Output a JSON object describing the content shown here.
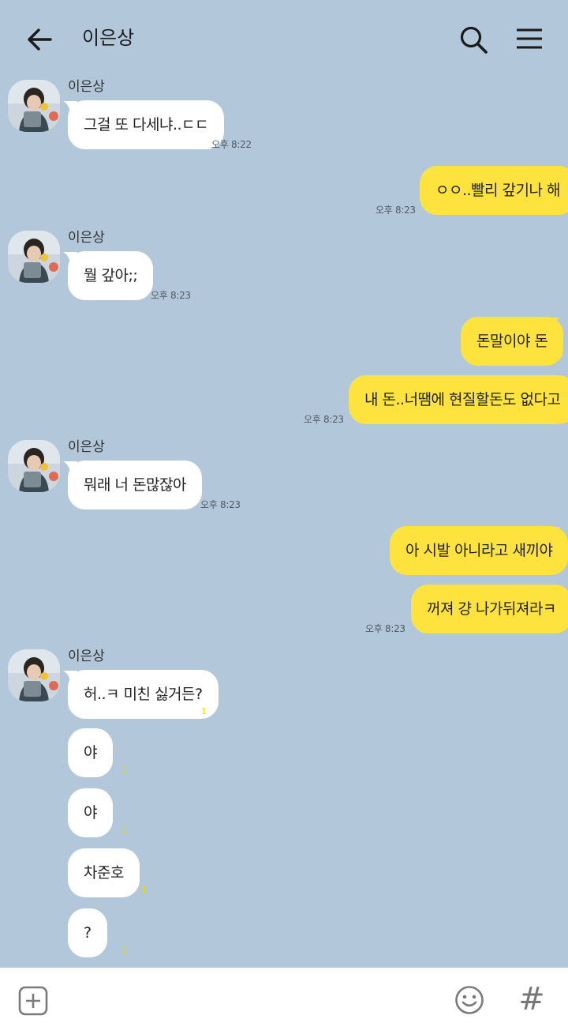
{
  "header": {
    "title": "이은상"
  },
  "sender_name": "이은상",
  "messages": {
    "m1": {
      "text": "그걸 또 다세냐..ㄷㄷ",
      "time": "오후 8:22"
    },
    "m2": {
      "text": "ㅇㅇ..빨리 갚기나 해",
      "time": "오후 8:23"
    },
    "m3": {
      "text": "뭘 갚아;;",
      "time": "오후 8:23"
    },
    "m4": {
      "text": "돈말이야 돈"
    },
    "m5": {
      "text": "내 돈..너땜에 현질할돈도 없다고",
      "time": "오후 8:23"
    },
    "m6": {
      "text": "뭐래 너 돈많잖아",
      "time": "오후 8:23"
    },
    "m7": {
      "text": "아 시발 아니라고 새끼야"
    },
    "m8": {
      "text": "꺼져 걍 나가뒤져라ㅋ",
      "time": "오후 8:23"
    },
    "m9": {
      "text": "허..ㅋ 미친 싫거든?",
      "unread": "1"
    },
    "m10": {
      "text": "야",
      "unread": "1"
    },
    "m11": {
      "text": "야",
      "unread": "1"
    },
    "m12": {
      "text": "차준호",
      "unread": "1"
    },
    "m13": {
      "text": "?",
      "unread": "1"
    }
  },
  "icons": {
    "back": "arrow-left-icon",
    "search": "search-icon",
    "menu": "hamburger-menu-icon",
    "plus": "plus-box-icon",
    "emoji": "emoji-face-icon",
    "hashtag": "hashtag-icon"
  },
  "bottombar": {
    "hash_glyph": "#"
  },
  "colors": {
    "background": "#b2c7da",
    "incoming_bubble": "#ffffff",
    "outgoing_bubble": "#fee33e",
    "unread": "#f3d400"
  }
}
